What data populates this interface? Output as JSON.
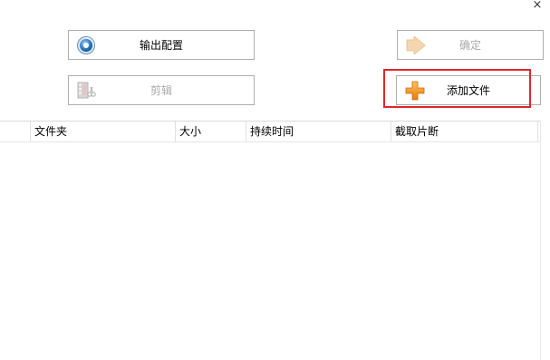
{
  "window": {
    "close_glyph": "×"
  },
  "toolbar": {
    "output_config_label": "输出配置",
    "output_config_icon": "gear-disc-icon",
    "confirm_label": "确定",
    "confirm_icon": "arrow-right-icon",
    "cut_label": "剪辑",
    "cut_icon": "film-scissors-icon",
    "add_file_label": "添加文件",
    "add_file_icon": "plus-icon"
  },
  "file_table": {
    "columns": [
      "",
      "文件夹",
      "大小",
      "持续时间",
      "截取片断"
    ],
    "rows": []
  },
  "colors": {
    "highlight": "#e0262a",
    "add_icon": "#f29a1a",
    "disabled_text": "#a8a8a8"
  }
}
